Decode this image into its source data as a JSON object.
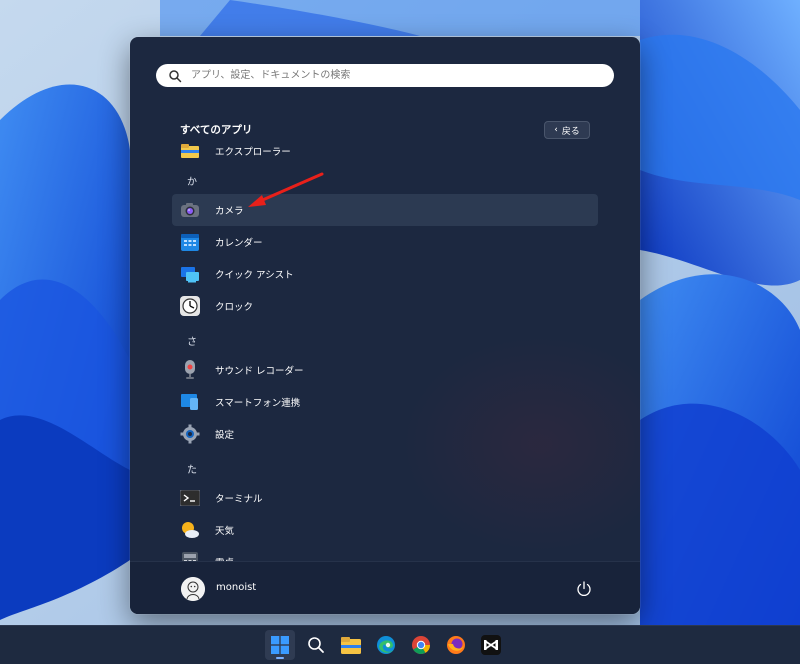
{
  "search": {
    "placeholder": "アプリ、設定、ドキュメントの検索"
  },
  "header": {
    "title": "すべてのアプリ",
    "back_label": "戻る"
  },
  "apps": [
    {
      "kind": "app",
      "label": "エクスプローラー",
      "icon": "file-explorer-icon"
    },
    {
      "kind": "letter",
      "label": "か"
    },
    {
      "kind": "app",
      "label": "カメラ",
      "icon": "camera-icon",
      "selected": true
    },
    {
      "kind": "app",
      "label": "カレンダー",
      "icon": "calendar-icon"
    },
    {
      "kind": "app",
      "label": "クイック アシスト",
      "icon": "quick-assist-icon"
    },
    {
      "kind": "app",
      "label": "クロック",
      "icon": "clock-icon"
    },
    {
      "kind": "letter",
      "label": "さ"
    },
    {
      "kind": "app",
      "label": "サウンド レコーダー",
      "icon": "sound-recorder-icon"
    },
    {
      "kind": "app",
      "label": "スマートフォン連携",
      "icon": "phone-link-icon"
    },
    {
      "kind": "app",
      "label": "設定",
      "icon": "settings-gear-icon"
    },
    {
      "kind": "letter",
      "label": "た"
    },
    {
      "kind": "app",
      "label": "ターミナル",
      "icon": "terminal-icon"
    },
    {
      "kind": "app",
      "label": "天気",
      "icon": "weather-icon"
    },
    {
      "kind": "app",
      "label": "電卓",
      "icon": "calculator-icon"
    }
  ],
  "user": {
    "name": "monoist"
  },
  "taskbar": [
    {
      "name": "start-button",
      "icon": "windows-logo-icon",
      "active": true
    },
    {
      "name": "taskbar-search-button",
      "icon": "search-icon"
    },
    {
      "name": "taskbar-file-explorer",
      "icon": "folder-icon"
    },
    {
      "name": "taskbar-edge",
      "icon": "edge-icon"
    },
    {
      "name": "taskbar-chrome",
      "icon": "chrome-icon"
    },
    {
      "name": "taskbar-firefox",
      "icon": "firefox-icon"
    },
    {
      "name": "taskbar-capcut",
      "icon": "capcut-icon"
    }
  ],
  "colors": {
    "menu_bg": "#1c2840",
    "accent": "#3a8bff",
    "annotation_arrow": "#e8201a"
  }
}
